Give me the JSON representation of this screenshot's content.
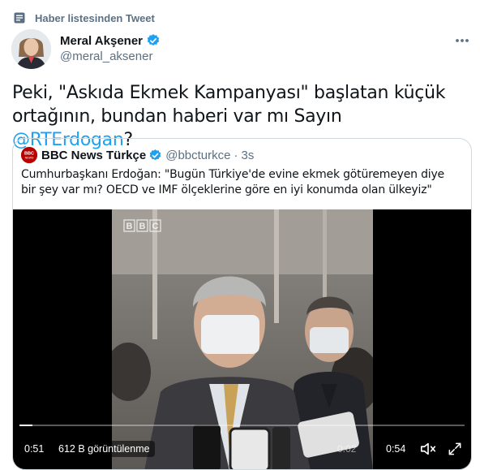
{
  "context": {
    "label": "Haber listesinden Tweet",
    "icon": "list-icon"
  },
  "tweet": {
    "author_name": "Meral Akşener",
    "author_handle": "@meral_aksener",
    "text_before_mention": "Peki, \"Askıda Ekmek Kampanyası\" başlatan küçük ortağının, bundan haberi var mı Sayın ",
    "mention": "@RTErdogan",
    "text_after_mention": "?"
  },
  "quoted_tweet": {
    "author_name": "BBC News Türkçe",
    "author_handle": "@bbcturkce",
    "separator": "·",
    "time": "3s",
    "avatar_text": "BBC",
    "avatar_subtext": "NEWS",
    "text": "Cumhurbaşkanı Erdoğan: \"Bugün Türkiye'de evine ekmek götüremeyen diye bir şey var mı? OECD ve IMF ölçeklerine göre en iyi konumda olan ülkeyiz\""
  },
  "video": {
    "elapsed": "0:51",
    "views": "612 B görüntülenme",
    "position": "0:02",
    "duration": "0:54",
    "watermark": "BBC",
    "progress": 0.03
  },
  "colors": {
    "accent": "#1da1f2",
    "secondary_text": "#5b7083",
    "verified": "#1da1f2",
    "border": "#cfd9de"
  }
}
